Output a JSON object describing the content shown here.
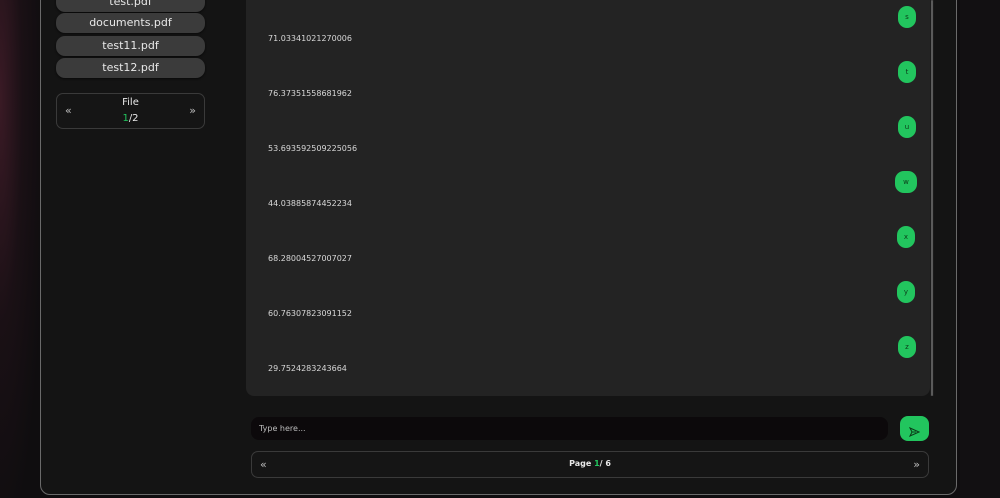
{
  "sidebar": {
    "files": [
      "test.pdf",
      "documents.pdf",
      "test11.pdf",
      "test12.pdf"
    ],
    "pager": {
      "title": "File",
      "current": "1",
      "total": "/2",
      "prev_icon": "«",
      "next_icon": "»"
    }
  },
  "chat": {
    "messages": [
      {
        "bubble": "s",
        "text": "71.03341021270006"
      },
      {
        "bubble": "t",
        "text": "76.37351558681962"
      },
      {
        "bubble": "u",
        "text": "53.693592509225056"
      },
      {
        "bubble": "w",
        "text": "44.03885874452234"
      },
      {
        "bubble": "x",
        "text": "68.28004527007027"
      },
      {
        "bubble": "y",
        "text": "60.76307823091152"
      },
      {
        "bubble": "z",
        "text": "29.7524283243664"
      }
    ]
  },
  "input": {
    "placeholder": "Type here...",
    "send_icon": "send-icon"
  },
  "page_pager": {
    "prefix": "Page ",
    "current": "1",
    "total": "/ 6",
    "prev_icon": "«",
    "next_icon": "»"
  },
  "colors": {
    "accent": "#22c55e",
    "panel": "#232323",
    "background": "#141414"
  }
}
